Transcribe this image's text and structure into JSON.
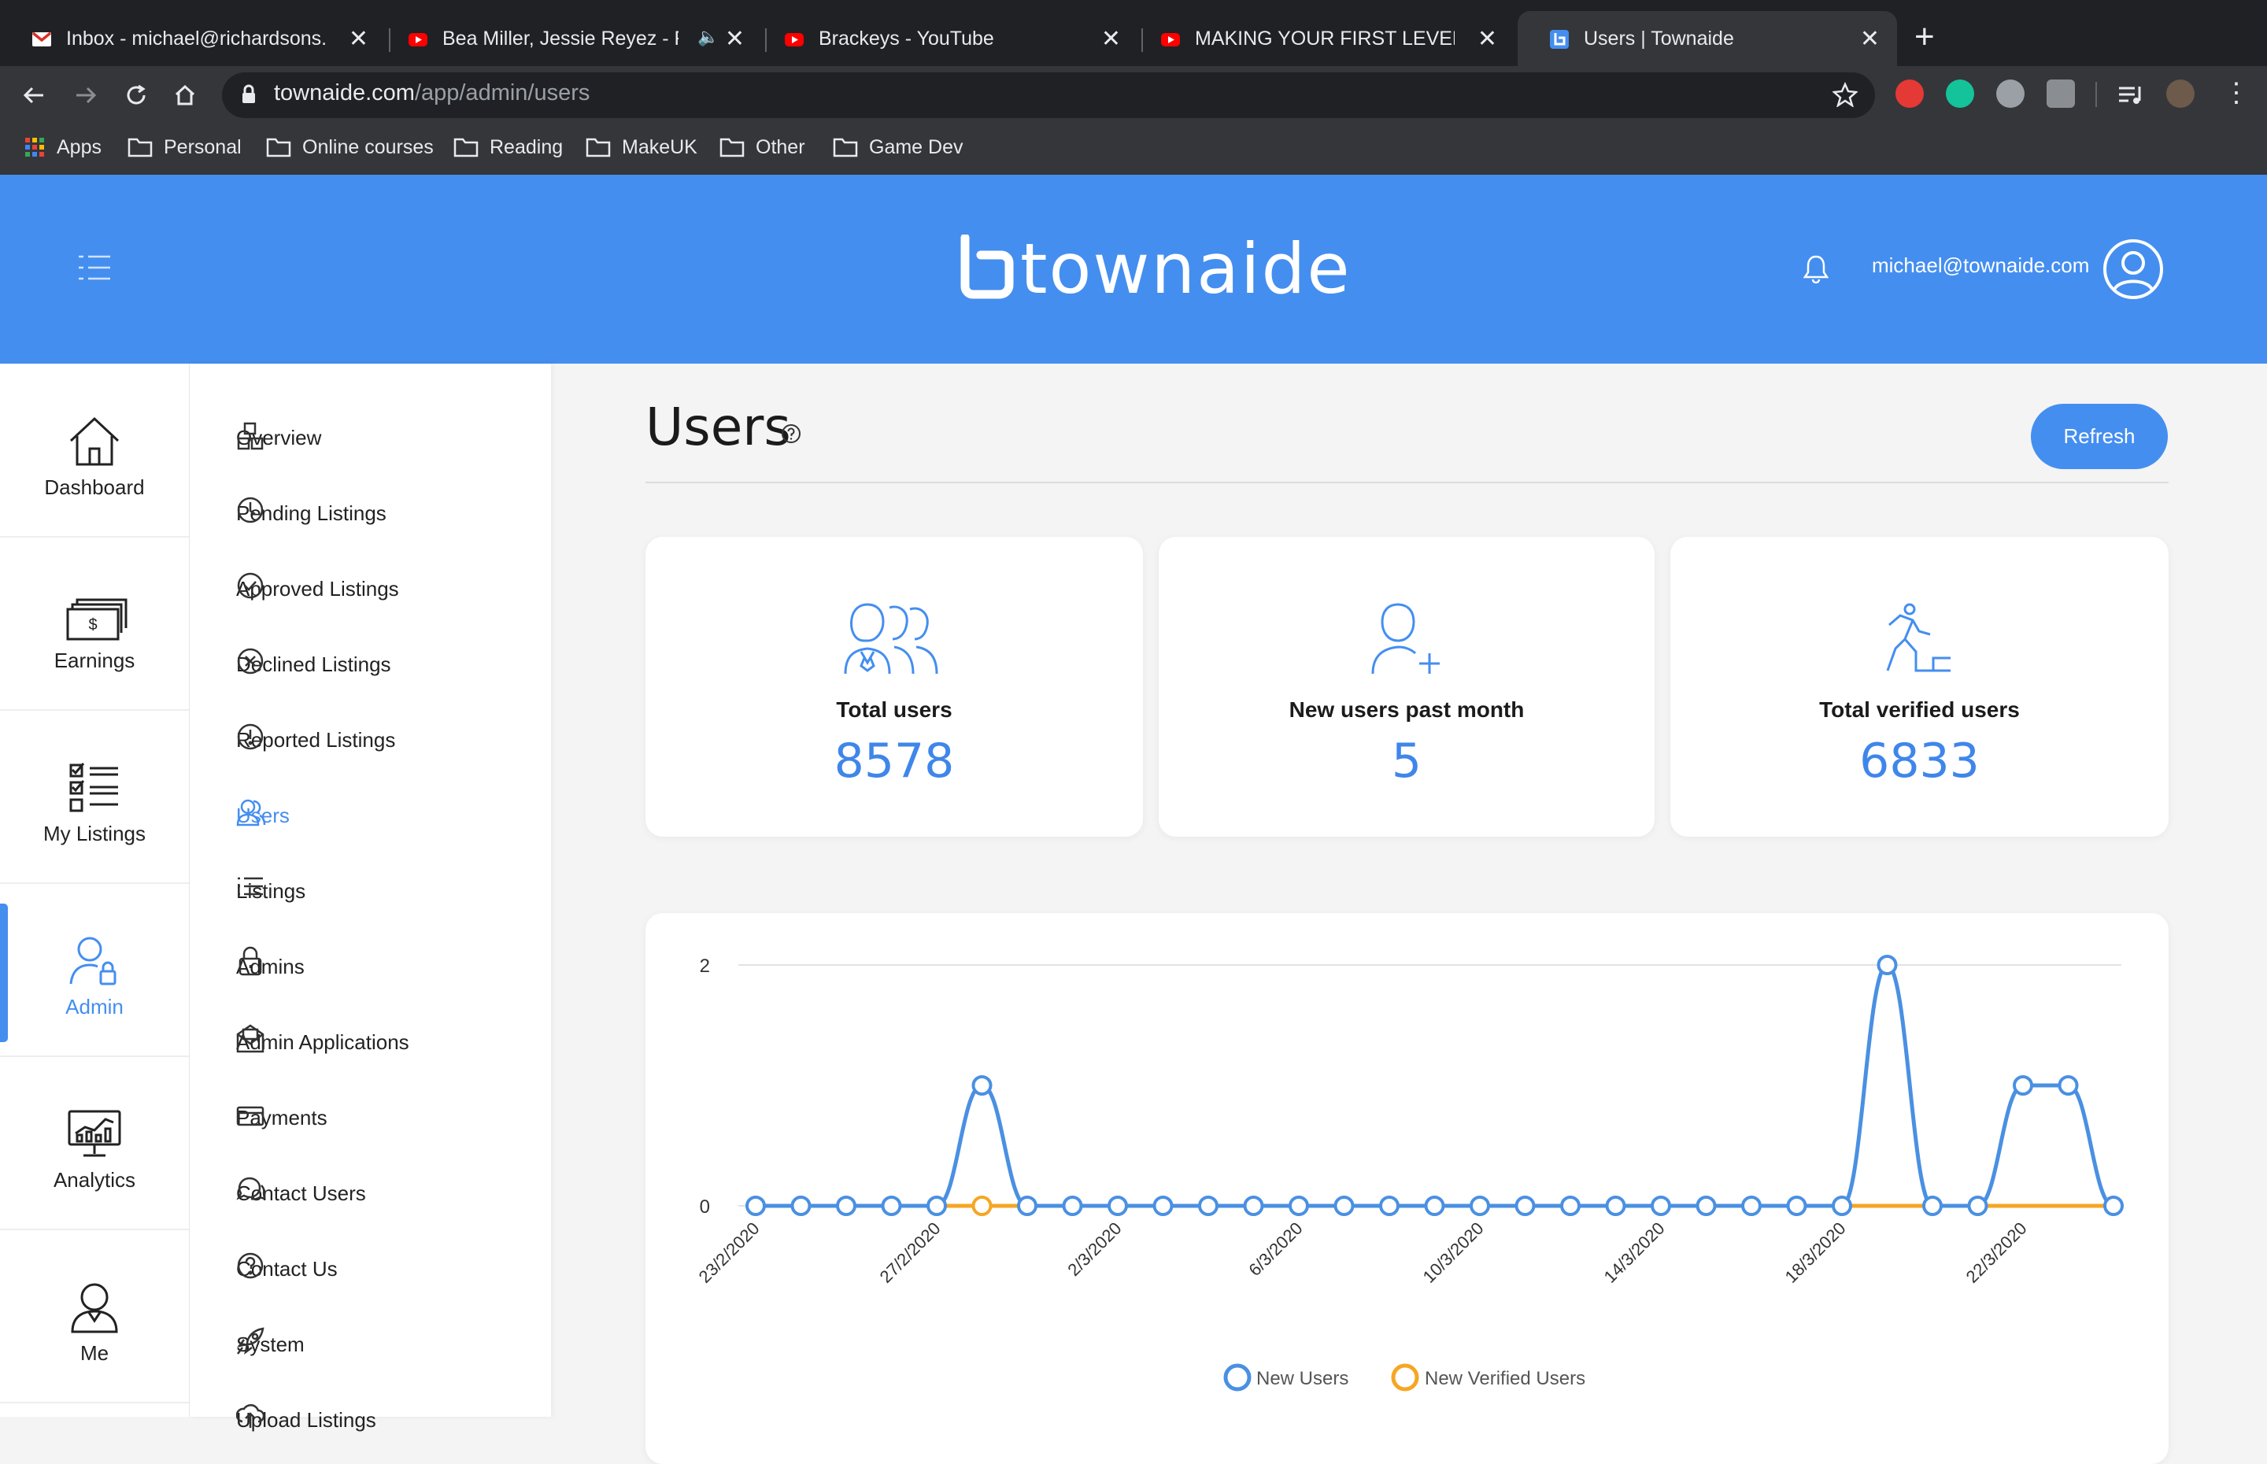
{
  "browser": {
    "tabs": [
      {
        "label": "Inbox - michael@richardsons.co",
        "icon": "gmail-icon"
      },
      {
        "label": "Bea Miller, Jessie Reyez - FE",
        "icon": "youtube-icon",
        "audio": true
      },
      {
        "label": "Brackeys - YouTube",
        "icon": "youtube-icon"
      },
      {
        "label": "MAKING YOUR FIRST LEVEL in U",
        "icon": "youtube-icon"
      },
      {
        "label": "Users | Townaide",
        "icon": "townaide-icon",
        "active": true
      }
    ],
    "url_host": "townaide.com",
    "url_path": "/app/admin/users",
    "bookmarks": [
      "Apps",
      "Personal",
      "Online courses",
      "Reading",
      "MakeUK",
      "Other",
      "Game Dev"
    ]
  },
  "header": {
    "logo": "townaide",
    "user_email": "michael@townaide.com"
  },
  "nav_primary": [
    {
      "label": "Dashboard",
      "icon": "home-icon"
    },
    {
      "label": "Earnings",
      "icon": "cash-icon"
    },
    {
      "label": "My Listings",
      "icon": "checklist-icon"
    },
    {
      "label": "Admin",
      "icon": "admin-user-lock-icon",
      "active": true
    },
    {
      "label": "Analytics",
      "icon": "analytics-monitor-icon"
    },
    {
      "label": "Me",
      "icon": "person-icon"
    }
  ],
  "nav_admin": [
    {
      "label": "Overview",
      "icon": "blocks-icon"
    },
    {
      "label": "Pending Listings",
      "icon": "clock-icon"
    },
    {
      "label": "Approved Listings",
      "icon": "check-circle-icon"
    },
    {
      "label": "Declined Listings",
      "icon": "x-circle-icon"
    },
    {
      "label": "Reported Listings",
      "icon": "exclamation-circle-icon"
    },
    {
      "label": "Users",
      "icon": "users-icon",
      "active": true
    },
    {
      "label": "Listings",
      "icon": "list-icon"
    },
    {
      "label": "Admins",
      "icon": "lock-icon"
    },
    {
      "label": "Admin Applications",
      "icon": "envelope-icon"
    },
    {
      "label": "Payments",
      "icon": "credit-card-icon"
    },
    {
      "label": "Contact Users",
      "icon": "chat-bubbles-icon"
    },
    {
      "label": "Contact Us",
      "icon": "question-circle-icon"
    },
    {
      "label": "System",
      "icon": "rocket-icon"
    },
    {
      "label": "Upload Listings",
      "icon": "upload-icon"
    }
  ],
  "main": {
    "title": "Users",
    "refresh_label": "Refresh",
    "stats": [
      {
        "label": "Total users",
        "value": "8578",
        "icon": "group-users-icon"
      },
      {
        "label": "New users past month",
        "value": "5",
        "icon": "add-user-icon"
      },
      {
        "label": "Total verified users",
        "value": "6833",
        "icon": "runner-icon"
      }
    ]
  },
  "colors": {
    "brand": "#448ef0",
    "series_new_users": "#4a90e2",
    "series_verified": "#f5a623"
  },
  "chart_data": {
    "type": "line",
    "x": [
      "23/2/2020",
      "24/2/2020",
      "25/2/2020",
      "26/2/2020",
      "27/2/2020",
      "28/2/2020",
      "29/2/2020",
      "1/3/2020",
      "2/3/2020",
      "3/3/2020",
      "4/3/2020",
      "5/3/2020",
      "6/3/2020",
      "7/3/2020",
      "8/3/2020",
      "9/3/2020",
      "10/3/2020",
      "11/3/2020",
      "12/3/2020",
      "13/3/2020",
      "14/3/2020",
      "15/3/2020",
      "16/3/2020",
      "17/3/2020",
      "18/3/2020",
      "19/3/2020",
      "20/3/2020",
      "21/3/2020",
      "22/3/2020",
      "23/3/2020",
      "24/3/2020",
      "25/3/2020"
    ],
    "x_tick_labels": [
      "23/2/2020",
      "27/2/2020",
      "2/3/2020",
      "6/3/2020",
      "10/3/2020",
      "14/3/2020",
      "18/3/2020",
      "22/3/2020"
    ],
    "y_tick_labels": [
      "0",
      "2"
    ],
    "ylim": [
      0,
      2
    ],
    "series": [
      {
        "name": "New Users",
        "values": [
          0,
          0,
          0,
          0,
          0,
          1,
          0,
          0,
          0,
          0,
          0,
          0,
          0,
          0,
          0,
          0,
          0,
          0,
          0,
          0,
          0,
          0,
          0,
          0,
          0,
          2,
          0,
          0,
          1,
          1,
          0
        ]
      },
      {
        "name": "New Verified Users",
        "values": [
          0,
          0,
          0,
          0,
          0,
          0,
          0,
          0,
          0,
          0,
          0,
          0,
          0,
          0,
          0,
          0,
          0,
          0,
          0,
          0,
          0,
          0,
          0,
          0,
          0,
          0,
          0,
          0,
          0,
          0,
          0
        ]
      }
    ],
    "legend_position": "bottom",
    "grid": true
  }
}
